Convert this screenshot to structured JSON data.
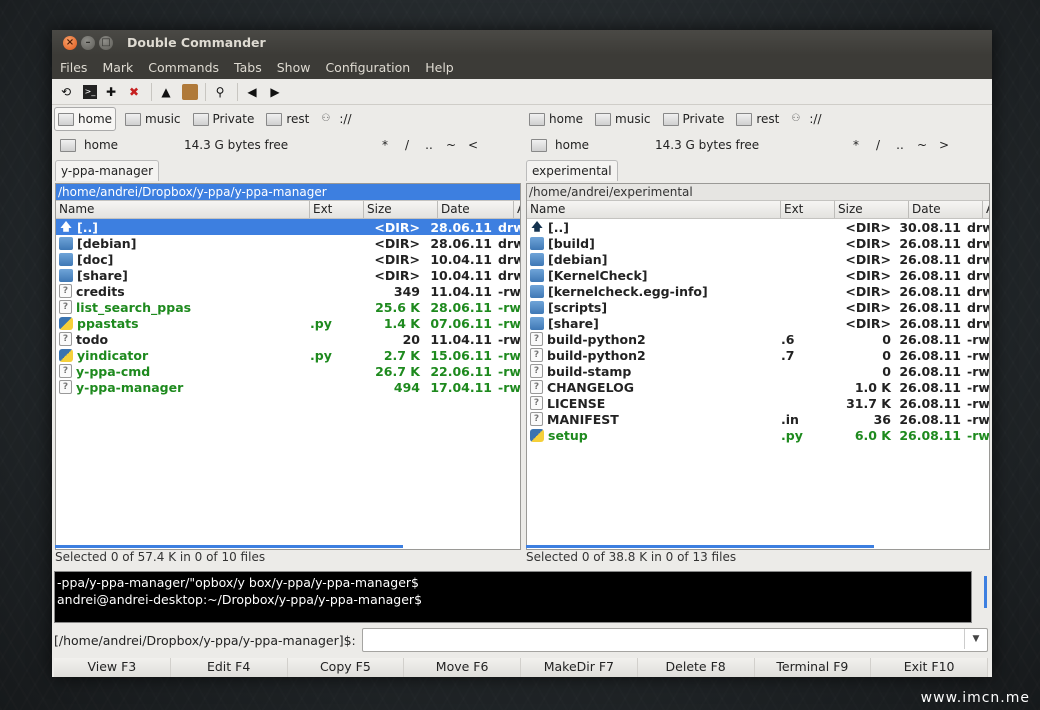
{
  "window": {
    "title": "Double Commander"
  },
  "menu": [
    "Files",
    "Mark",
    "Commands",
    "Tabs",
    "Show",
    "Configuration",
    "Help"
  ],
  "toolbar": {
    "icons": [
      "refresh-icon",
      "terminal-icon",
      "plus-icon",
      "delete-icon",
      "up-arrow-icon",
      "archive-icon",
      "search-icon",
      "back-icon",
      "forward-icon"
    ]
  },
  "left": {
    "drives": [
      "home",
      "music",
      "Private",
      "rest",
      "://"
    ],
    "drive_name": "home",
    "free_space": "14.3 G bytes free",
    "nav": [
      "*",
      "/",
      "..",
      "~",
      "<"
    ],
    "tab": "y-ppa-manager",
    "path": "/home/andrei/Dropbox/y-ppa/y-ppa-manager",
    "columns": [
      "Name",
      "Ext",
      "Size",
      "Date",
      "Attr"
    ],
    "files": [
      {
        "name": "[..]",
        "ext": "",
        "size": "<DIR>",
        "date": "28.06.11",
        "attr": "drwx",
        "icon": "up",
        "style": "sel"
      },
      {
        "name": "[debian]",
        "ext": "",
        "size": "<DIR>",
        "date": "28.06.11",
        "attr": "drwx",
        "icon": "folder",
        "style": "normal"
      },
      {
        "name": "[doc]",
        "ext": "",
        "size": "<DIR>",
        "date": "10.04.11",
        "attr": "drwx",
        "icon": "folder",
        "style": "normal"
      },
      {
        "name": "[share]",
        "ext": "",
        "size": "<DIR>",
        "date": "10.04.11",
        "attr": "drwx",
        "icon": "folder",
        "style": "normal"
      },
      {
        "name": "credits",
        "ext": "",
        "size": "349",
        "date": "11.04.11",
        "attr": "-rw-",
        "icon": "file",
        "style": "normal"
      },
      {
        "name": "list_search_ppas",
        "ext": "",
        "size": "25.6 K",
        "date": "28.06.11",
        "attr": "-rwx",
        "icon": "file",
        "style": "green"
      },
      {
        "name": "ppastats",
        "ext": ".py",
        "size": "1.4 K",
        "date": "07.06.11",
        "attr": "-rwx",
        "icon": "py",
        "style": "green"
      },
      {
        "name": "todo",
        "ext": "",
        "size": "20",
        "date": "11.04.11",
        "attr": "-rw-",
        "icon": "file",
        "style": "normal"
      },
      {
        "name": "yindicator",
        "ext": ".py",
        "size": "2.7 K",
        "date": "15.06.11",
        "attr": "-rwx",
        "icon": "py",
        "style": "green"
      },
      {
        "name": "y-ppa-cmd",
        "ext": "",
        "size": "26.7 K",
        "date": "22.06.11",
        "attr": "-rwx",
        "icon": "file",
        "style": "green"
      },
      {
        "name": "y-ppa-manager",
        "ext": "",
        "size": "494",
        "date": "17.04.11",
        "attr": "-rwx",
        "icon": "file",
        "style": "green"
      }
    ],
    "status": "Selected 0 of 57.4 K in 0 of 10 files"
  },
  "right": {
    "drives": [
      "home",
      "music",
      "Private",
      "rest",
      "://"
    ],
    "drive_name": "home",
    "free_space": "14.3 G bytes free",
    "nav": [
      "*",
      "/",
      "..",
      "~",
      ">"
    ],
    "tab": "experimental",
    "path": "/home/andrei/experimental",
    "columns": [
      "Name",
      "Ext",
      "Size",
      "Date",
      "Attr"
    ],
    "files": [
      {
        "name": "[..]",
        "ext": "",
        "size": "<DIR>",
        "date": "30.08.11",
        "attr": "drwx",
        "icon": "up",
        "style": "normal"
      },
      {
        "name": "[build]",
        "ext": "",
        "size": "<DIR>",
        "date": "26.08.11",
        "attr": "drwx",
        "icon": "folder",
        "style": "normal"
      },
      {
        "name": "[debian]",
        "ext": "",
        "size": "<DIR>",
        "date": "26.08.11",
        "attr": "drwx",
        "icon": "folder",
        "style": "normal"
      },
      {
        "name": "[KernelCheck]",
        "ext": "",
        "size": "<DIR>",
        "date": "26.08.11",
        "attr": "drwx",
        "icon": "folder",
        "style": "normal"
      },
      {
        "name": "[kernelcheck.egg-info]",
        "ext": "",
        "size": "<DIR>",
        "date": "26.08.11",
        "attr": "drwx",
        "icon": "folder",
        "style": "normal"
      },
      {
        "name": "[scripts]",
        "ext": "",
        "size": "<DIR>",
        "date": "26.08.11",
        "attr": "drwx",
        "icon": "folder",
        "style": "normal"
      },
      {
        "name": "[share]",
        "ext": "",
        "size": "<DIR>",
        "date": "26.08.11",
        "attr": "drwx",
        "icon": "folder",
        "style": "normal"
      },
      {
        "name": "build-python2",
        "ext": ".6",
        "size": "0",
        "date": "26.08.11",
        "attr": "-rw-",
        "icon": "file",
        "style": "normal"
      },
      {
        "name": "build-python2",
        "ext": ".7",
        "size": "0",
        "date": "26.08.11",
        "attr": "-rw-",
        "icon": "file",
        "style": "normal"
      },
      {
        "name": "build-stamp",
        "ext": "",
        "size": "0",
        "date": "26.08.11",
        "attr": "-rw-",
        "icon": "file",
        "style": "normal"
      },
      {
        "name": "CHANGELOG",
        "ext": "",
        "size": "1.0 K",
        "date": "26.08.11",
        "attr": "-rw-",
        "icon": "file",
        "style": "normal"
      },
      {
        "name": "LICENSE",
        "ext": "",
        "size": "31.7 K",
        "date": "26.08.11",
        "attr": "-rw-",
        "icon": "file",
        "style": "normal"
      },
      {
        "name": "MANIFEST",
        "ext": ".in",
        "size": "36",
        "date": "26.08.11",
        "attr": "-rw-",
        "icon": "file",
        "style": "normal"
      },
      {
        "name": "setup",
        "ext": ".py",
        "size": "6.0 K",
        "date": "26.08.11",
        "attr": "-rwx",
        "icon": "py",
        "style": "green"
      }
    ],
    "status": "Selected 0 of 38.8 K in 0 of 13 files"
  },
  "terminal": {
    "line1": "-ppa/y-ppa-manager/\"opbox/y box/y-ppa/y-ppa-manager$",
    "line2": "andrei@andrei-desktop:~/Dropbox/y-ppa/y-ppa-manager$"
  },
  "command_line": {
    "path": "[/home/andrei/Dropbox/y-ppa/y-ppa-manager]$:",
    "value": ""
  },
  "fkeys": [
    "View F3",
    "Edit F4",
    "Copy F5",
    "Move F6",
    "MakeDir F7",
    "Delete F8",
    "Terminal F9",
    "Exit F10"
  ],
  "watermark": "www.imcn.me",
  "colors": {
    "selection": "#3d7fe0",
    "executable": "#1e8a1e",
    "titlebar": "#3c3b37",
    "close_button": "#e0571b"
  }
}
